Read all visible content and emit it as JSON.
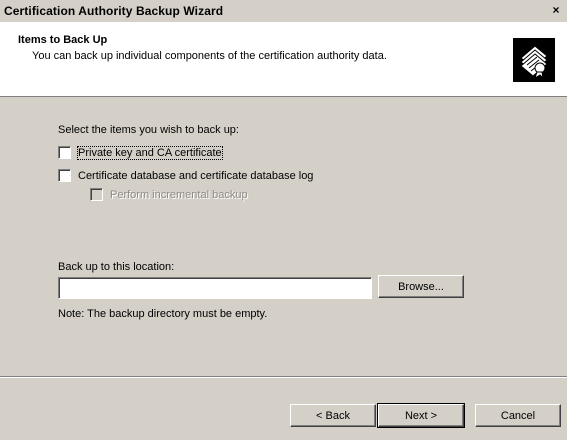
{
  "window": {
    "title": "Certification Authority Backup Wizard",
    "close_glyph": "×"
  },
  "header": {
    "title": "Items to Back Up",
    "subtitle": "You can back up individual components of the certification authority data.",
    "icon": "certificate-icon"
  },
  "content": {
    "prompt": "Select the items you wish to back up:",
    "options": [
      {
        "label": "Private key and CA certificate",
        "checked": false,
        "enabled": true
      },
      {
        "label": "Certificate database and certificate database log",
        "checked": false,
        "enabled": true
      },
      {
        "label": "Perform incremental backup",
        "checked": false,
        "enabled": false
      }
    ],
    "location_label": "Back up to this location:",
    "location_value": "",
    "browse_label": "Browse...",
    "note": "Note: The backup directory must be empty."
  },
  "footer": {
    "back_label": "< Back",
    "next_label": "Next >",
    "cancel_label": "Cancel"
  }
}
